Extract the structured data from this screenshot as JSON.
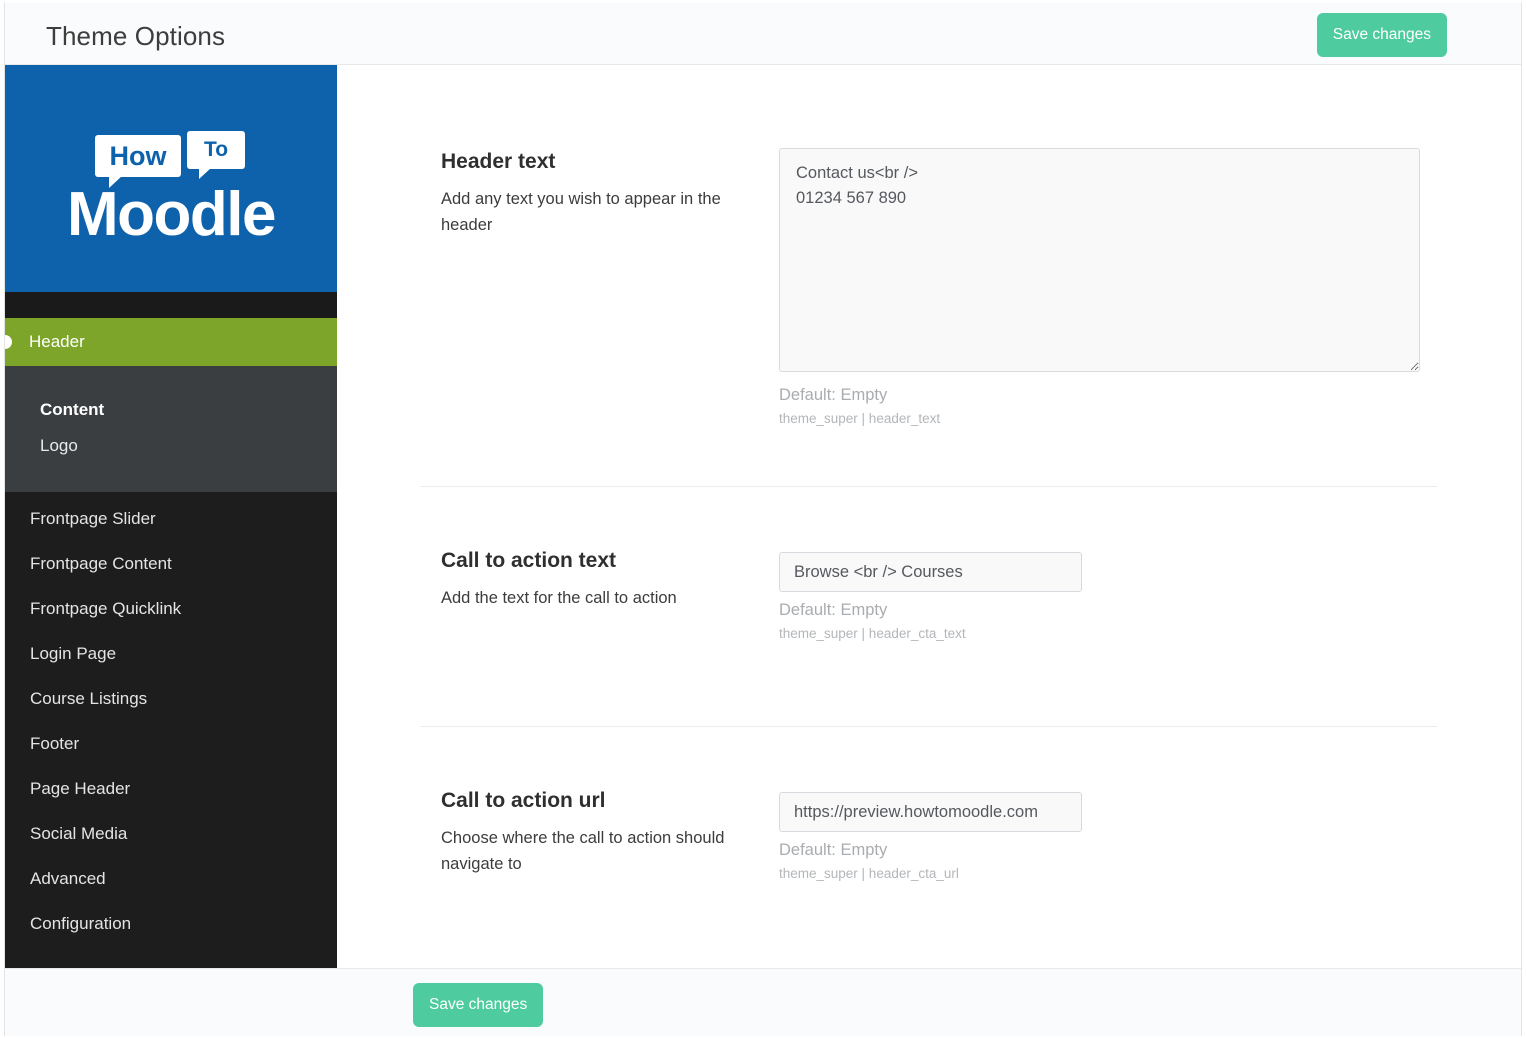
{
  "topbar": {
    "title": "Theme Options",
    "save_label": "Save changes"
  },
  "sidebar": {
    "logo": {
      "bubble_how": "How",
      "bubble_to": "To",
      "word": "Moodle"
    },
    "active_section": "Header",
    "submenu": [
      {
        "label": "Content",
        "current": true
      },
      {
        "label": "Logo",
        "current": false
      }
    ],
    "items": [
      {
        "label": "Frontpage Slider"
      },
      {
        "label": "Frontpage Content"
      },
      {
        "label": "Frontpage Quicklink"
      },
      {
        "label": "Login Page"
      },
      {
        "label": "Course Listings"
      },
      {
        "label": "Footer"
      },
      {
        "label": "Page Header"
      },
      {
        "label": "Social Media"
      },
      {
        "label": "Advanced"
      },
      {
        "label": "Configuration"
      }
    ]
  },
  "fields": {
    "header_text": {
      "title": "Header text",
      "description": "Add any text you wish to appear in the header",
      "value": "Contact us<br />\n01234 567 890",
      "default": "Default: Empty",
      "meta": "theme_super | header_text"
    },
    "cta_text": {
      "title": "Call to action text",
      "description": "Add the text for the call to action",
      "value": "Browse <br /> Courses",
      "default": "Default: Empty",
      "meta": "theme_super | header_cta_text"
    },
    "cta_url": {
      "title": "Call to action url",
      "description": "Choose where the call to action should navigate to",
      "value": "https://preview.howtomoodle.com",
      "default": "Default: Empty",
      "meta": "theme_super | header_cta_url"
    }
  },
  "footer": {
    "save_label": "Save changes"
  },
  "colors": {
    "accent_green": "#4ecca0",
    "nav_active_green": "#7ca52a",
    "logo_blue": "#0e62ab",
    "sidebar_dark": "#1d1d1d",
    "submenu_dark": "#3b3e41"
  }
}
